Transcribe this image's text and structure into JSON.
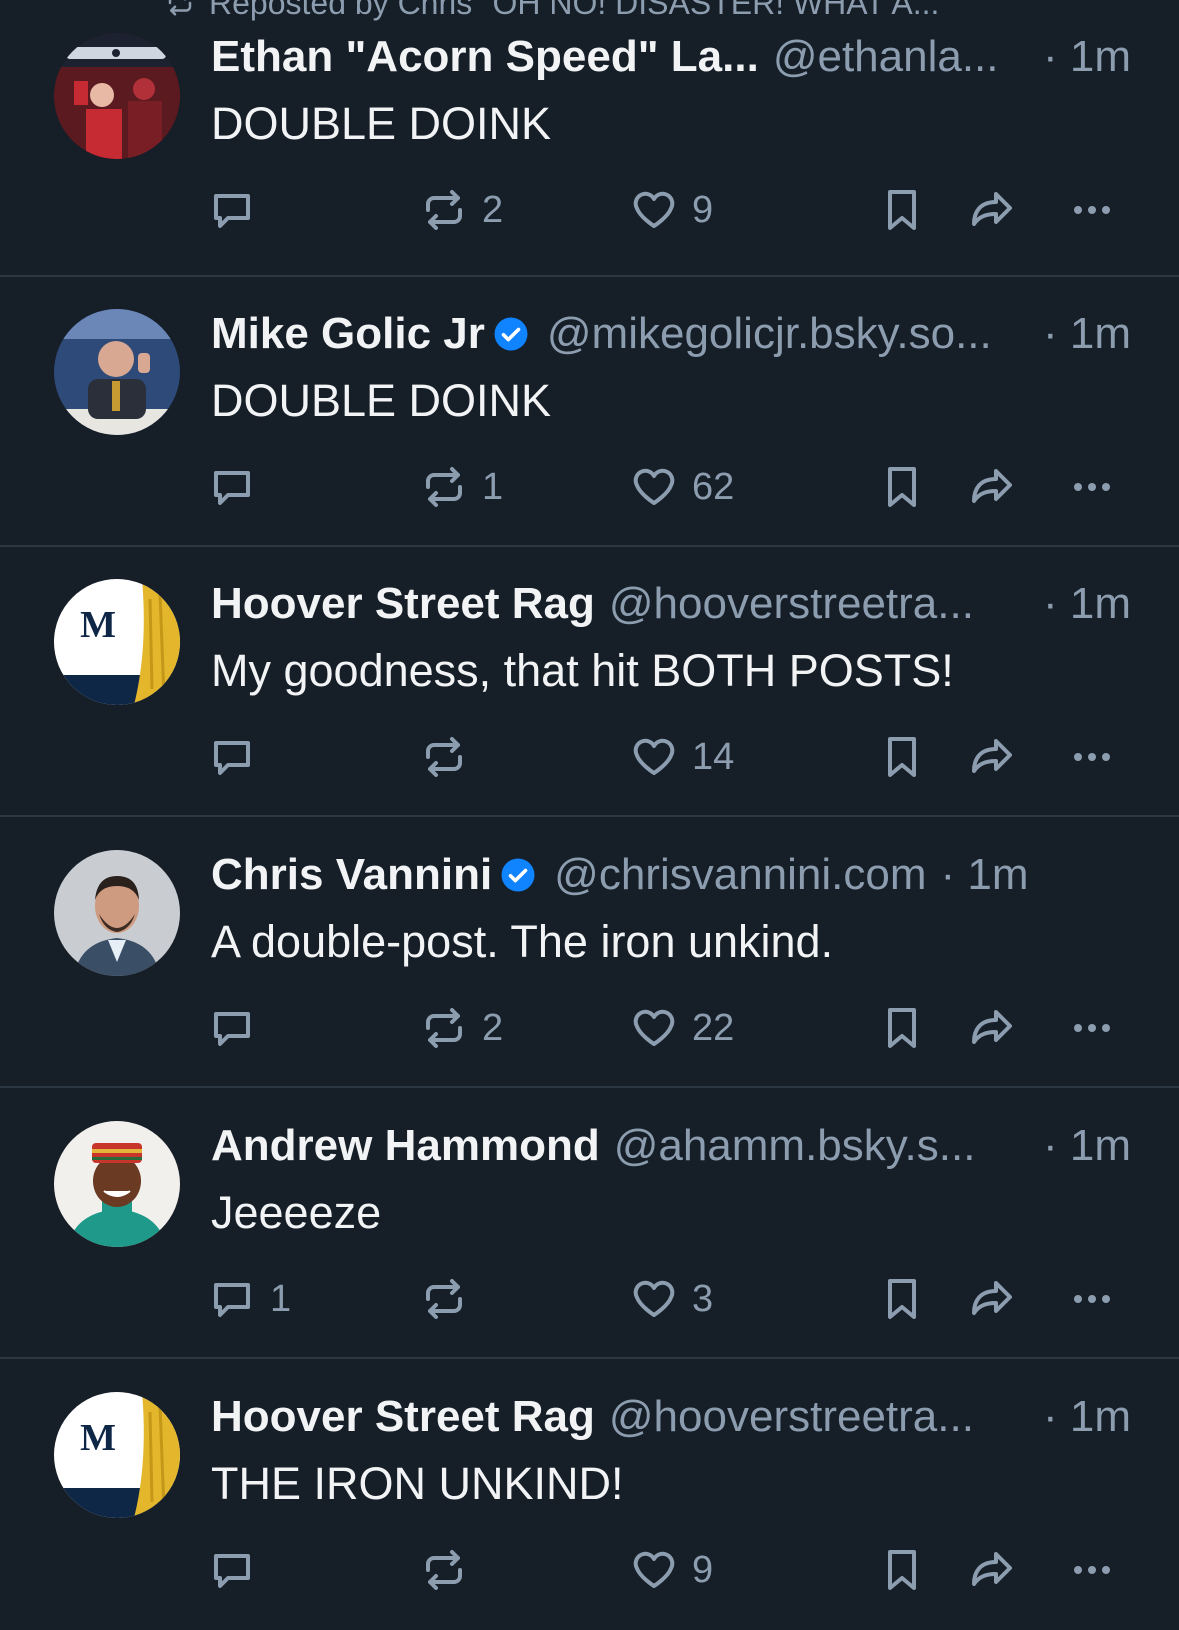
{
  "repost_banner": "Reposted by Chris  \"OH NO! DISASTER! WHAT A...",
  "posts": [
    {
      "name": "Ethan \"Acorn Speed\" La...",
      "verified": false,
      "handle": "@ethanla...",
      "time": "· 1m",
      "text": "DOUBLE DOINK",
      "reply_count": "",
      "repost_count": "2",
      "like_count": "9",
      "avatar": "ethan-avatar"
    },
    {
      "name": "Mike Golic Jr",
      "verified": true,
      "handle": "@mikegolicjr.bsky.so...",
      "time": "· 1m",
      "text": "DOUBLE DOINK",
      "reply_count": "",
      "repost_count": "1",
      "like_count": "62",
      "avatar": "mike-avatar"
    },
    {
      "name": "Hoover Street Rag",
      "verified": false,
      "handle": "@hooverstreetra...",
      "time": "· 1m",
      "text": "My goodness, that hit BOTH POSTS!",
      "reply_count": "",
      "repost_count": "",
      "like_count": "14",
      "avatar": "hoover-avatar",
      "avatar_letter": "M"
    },
    {
      "name": "Chris Vannini",
      "verified": true,
      "handle": "@chrisvannini.com",
      "time": "· 1m",
      "text": "A double-post. The iron unkind.",
      "reply_count": "",
      "repost_count": "2",
      "like_count": "22",
      "avatar": "chris-avatar"
    },
    {
      "name": "Andrew Hammond",
      "verified": false,
      "handle": "@ahamm.bsky.s...",
      "time": "· 1m",
      "text": "Jeeeeze",
      "reply_count": "1",
      "repost_count": "",
      "like_count": "3",
      "avatar": "andrew-avatar"
    },
    {
      "name": "Hoover Street Rag",
      "verified": false,
      "handle": "@hooverstreetra...",
      "time": "· 1m",
      "text": "THE IRON UNKIND!",
      "reply_count": "",
      "repost_count": "",
      "like_count": "9",
      "avatar": "hoover-avatar",
      "avatar_letter": "M"
    }
  ],
  "colors": {
    "background": "#161e27",
    "muted": "#8d9db0",
    "verified": "#1083fe",
    "divider": "#2c3744"
  }
}
